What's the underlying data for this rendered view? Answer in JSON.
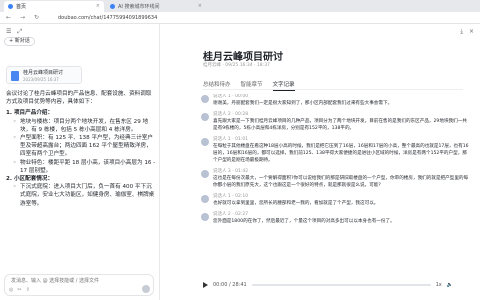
{
  "browser": {
    "active_tab": "首页",
    "inactive_tab": "AI 搜索城市环线间",
    "url": "doubao.com/chat/14775994091899634"
  },
  "chat": {
    "new_conversation": "+ 新对话",
    "file": {
      "name": "桂月云峰项目研讨",
      "date": "2023/09/25 16:37"
    },
    "intro": "会议讨论了桂月云峰项目的产品信息、配套设施、资料调取方式及项目优势等内容，具体如下：",
    "section1": "1. 项目产品介绍：",
    "bullets1": [
      "地块与楼栋：项目分两个地块开发，在售东区 29 地块，有 9 栋楼，包括 5 栋小高层和 4 栋洋房。",
      "户型面积：有 125 平、138 平户型，为经典三计室户型及带超高露台；两边四面 162 平个屋型精致洋房，四室有两个卫户型。",
      "物业特色：楼距平距 18 层小高，该项目小高层为 16 - 17 层别墅。"
    ],
    "section2": "2. 小区配套情况：",
    "bullets2": [
      "下沉式庭院：进入项目大门后，负一首有 400 平下沉式庭院，安业七大功能区，如健身房、瑜伽室、棋牌桌游室等。"
    ],
    "composer": {
      "placeholder": "发消息、输入 @ 选择技能或 / 选择文件",
      "tools": [
        "◎",
        "✂",
        "⇪"
      ]
    }
  },
  "doc": {
    "title": "桂月云峰项目研讨",
    "meta": "桂月云峰 · 09/25 16:34 · 18:37",
    "tabs": [
      "总结和待办",
      "智能章节",
      "文字记录"
    ],
    "active_tab_index": 2,
    "transcript": [
      {
        "speaker": "说话人 1 · 00:00",
        "text": "谢谢美，丹丽配套我们一定是很大家知到了，那小区内部配套我们过来有些大事会需下。"
      },
      {
        "speaker": "说话人 2 · 00:28",
        "text": "喜先跟大家是一下我们桂月云峰项目的几种产品，项目分为了两个地块开发，目前在售的是我们的东区产品，29地块我们一共是有9栋楼的，5栋小高层和4栋洋房，分别是有152平的，138平的。"
      },
      {
        "speaker": "说话人 1 · 01:01",
        "text": "在每粒于其他楼盘在看这种18层小高的时候，我们是把它压到了16层，16层和17层的小高，整个最高的也就是17层，也有16层的，16层和16层的，都可以选择，我们前125、138平得大家便捷的是进驻小区域的时候，洋房是有两个152平的户型，那个户型的是刚在场最极期待。"
      },
      {
        "speaker": "说话人 3 · 01:42",
        "text": "这也是在每份次最大，一个要解得面积?你可以说给我们的那是研旧取楼盘的一个户型，你审的楼房，我们的就是把产型里的每你都小层的我们原先大，这个也跟这是一个很好的特点，就是那就很是么说，可能?"
      },
      {
        "speaker": "说话人 1 · 02:10",
        "text": "也好就可以拿到里里，您所长的腰部和老一我的，看加就是了个产型，我这可以。"
      },
      {
        "speaker": "说话人 2 · 02:27",
        "text": "您外面是1800的在你了，然后最近了，个量这个项目的对高多出可以以本身也有一份了。"
      }
    ],
    "player": {
      "time": "00:00 / 28:41",
      "speed": "1x",
      "progress": 0.0
    }
  }
}
